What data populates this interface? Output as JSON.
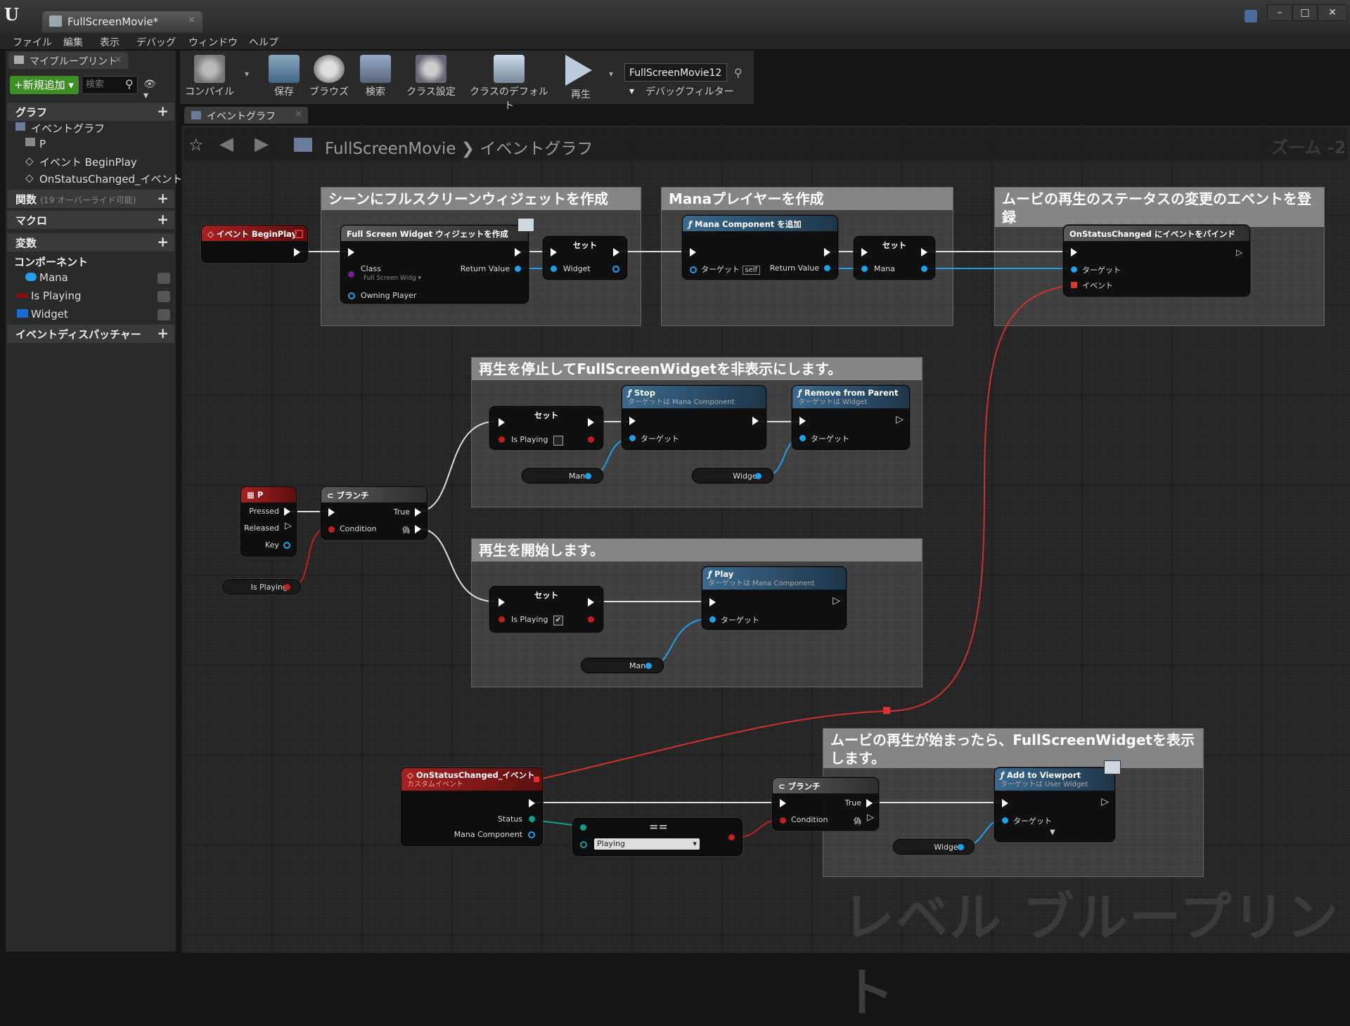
{
  "window": {
    "logo": "U",
    "tab_title": "FullScreenMovie*",
    "tab_close": "×",
    "min": "–",
    "max": "□",
    "close": "✕"
  },
  "menu": [
    "ファイル",
    "編集",
    "表示",
    "デバッグ",
    "ウィンドウ",
    "ヘルプ"
  ],
  "left_panel": {
    "tab_title": "マイブループリント",
    "tab_close": "×",
    "add_new": "+新規追加 ▾",
    "search_placeholder": "検索",
    "categories": {
      "graph": "グラフ",
      "functions": "関数",
      "functions_sub": "(19 オーバーライド可能)",
      "macros": "マクロ",
      "variables": "変数",
      "components": "コンポーネント",
      "dispatchers": "イベントディスパッチャー"
    },
    "graph_items": [
      "イベントグラフ",
      "P",
      "イベント BeginPlay",
      "OnStatusChanged_イベント"
    ],
    "components": [
      "Mana",
      "Is Playing",
      "Widget"
    ],
    "component_colors": [
      "#1fa0e8",
      "#8b1010",
      "#1a6ad8"
    ]
  },
  "toolbar": {
    "buttons": [
      "コンパイル",
      "保存",
      "ブラウズ",
      "検索",
      "クラス設定",
      "クラスのデフォルト",
      "再生"
    ],
    "filter_value": "FullScreenMovie12 ▾",
    "filter_label": "デバッグフィルター"
  },
  "graph_tab": {
    "label": "イベントグラフ",
    "close": "×"
  },
  "breadcrumb": {
    "text": "FullScreenMovie ❯ イベントグラフ",
    "zoom": "ズーム -2"
  },
  "watermark": "レベル ブループリント",
  "comments": [
    "シーンにフルスクリーンウィジェットを作成",
    "Manaプレイヤーを作成",
    "ムービの再生のステータスの変更のエベントを登録",
    "再生を停止してFullScreenWidgetを非表示にします。",
    "再生を開始します。",
    "ムービの再生が始まったら、FullScreenWidgetを表示します。"
  ],
  "nodes": {
    "begin_play": "イベント BeginPlay",
    "create_widget": {
      "title": "Full Screen Widget ウィジェットを作成",
      "class": "Class",
      "class_value": "Full Screen Widg ▾",
      "return": "Return Value",
      "owning": "Owning Player"
    },
    "set1": {
      "title": "セット",
      "pin": "Widget"
    },
    "add_mana": {
      "title": "Mana Component を追加",
      "target": "ターゲット",
      "self": "self",
      "return": "Return Value"
    },
    "set2": {
      "title": "セット",
      "pin": "Mana"
    },
    "bind": {
      "title": "OnStatusChanged にイベントをバインド",
      "target": "ターゲット",
      "event": "イベント"
    },
    "set3": {
      "title": "セット",
      "pin": "Is Playing"
    },
    "stop": {
      "title": "Stop",
      "sub": "ターゲットは Mana Component",
      "target": "ターゲット"
    },
    "remove": {
      "title": "Remove from Parent",
      "sub": "ターゲットは Widget",
      "target": "ターゲット"
    },
    "get_mana1": "Mana",
    "get_widget1": "Widget",
    "key_p": {
      "title": "P",
      "pressed": "Pressed",
      "released": "Released",
      "key": "Key"
    },
    "branch1": {
      "title": "ブランチ",
      "true": "True",
      "condition": "Condition",
      "false": "偽"
    },
    "get_playing": "Is Playing",
    "set4": {
      "title": "セット",
      "pin": "Is Playing",
      "check": "✔"
    },
    "play": {
      "title": "Play",
      "sub": "ターゲットは Mana Component",
      "target": "ターゲット"
    },
    "get_mana2": "Mana",
    "on_status": {
      "title": "OnStatusChanged_イベント",
      "sub": "カスタムイベント",
      "status": "Status",
      "mana": "Mana Component"
    },
    "equal": {
      "symbol": "==",
      "value": "Playing"
    },
    "branch2": {
      "title": "ブランチ",
      "true": "True",
      "condition": "Condition",
      "false": "偽"
    },
    "add_viewport": {
      "title": "Add to Viewport",
      "sub": "ターゲットは User Widget",
      "target": "ターゲット"
    },
    "get_widget2": "Widget"
  },
  "colors": {
    "event_header": "#a82020",
    "function_header": "#3a6a8e",
    "object_pin": "#1fa0e8",
    "bool_pin": "#c02020",
    "delegate_wire": "#d03030"
  }
}
